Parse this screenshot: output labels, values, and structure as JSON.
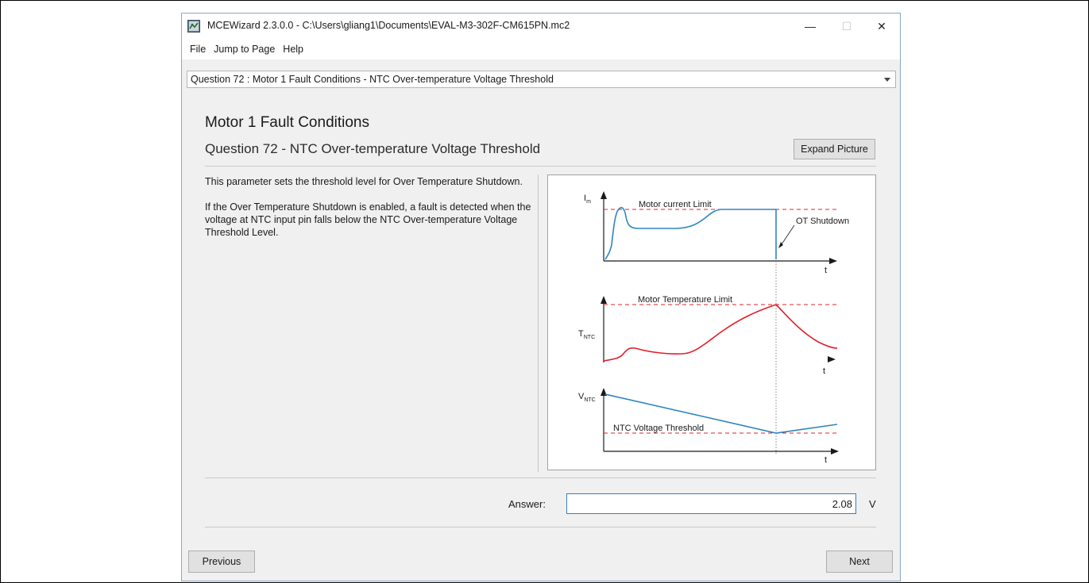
{
  "window": {
    "title": "MCEWizard 2.3.0.0  - C:\\Users\\gliang1\\Documents\\EVAL-M3-302F-CM615PN.mc2",
    "controls": {
      "minimize": "—",
      "maximize": "☐",
      "close": "✕"
    },
    "icon": "app-logo-icon"
  },
  "menu": {
    "items": [
      {
        "label": "File"
      },
      {
        "label": "Jump to Page"
      },
      {
        "label": "Help"
      }
    ]
  },
  "question_select": {
    "value": "Question  72 : Motor 1 Fault Conditions - NTC Over-temperature Voltage Threshold"
  },
  "page": {
    "section_title": "Motor 1 Fault Conditions",
    "question_title": "Question 72 - NTC Over-temperature Voltage Threshold",
    "expand_label": "Expand Picture",
    "description": [
      "This parameter sets the threshold level for Over Temperature Shutdown.",
      "If the Over Temperature Shutdown is enabled, a fault is detected when the voltage at NTC input pin falls below the NTC Over-temperature Voltage Threshold Level."
    ]
  },
  "diagram": {
    "labels": {
      "current_axis": "I",
      "current_sub": "m",
      "current_limit": "Motor current Limit",
      "ot_shutdown": "OT Shutdown",
      "temp_axis": "T",
      "temp_sub": "NTC",
      "temp_limit": "Motor Temperature Limit",
      "volt_axis": "V",
      "volt_sub": "NTC",
      "volt_threshold": "NTC Voltage Threshold",
      "time": "t"
    },
    "colors": {
      "current": "#2e86c1",
      "temperature": "#e0202a",
      "voltage": "#2e86c1",
      "limit_line": "#e0202a",
      "axis": "#1a1a1a"
    }
  },
  "answer": {
    "label": "Answer:",
    "value": "2.08",
    "unit": "V"
  },
  "nav": {
    "previous": "Previous",
    "next": "Next"
  }
}
